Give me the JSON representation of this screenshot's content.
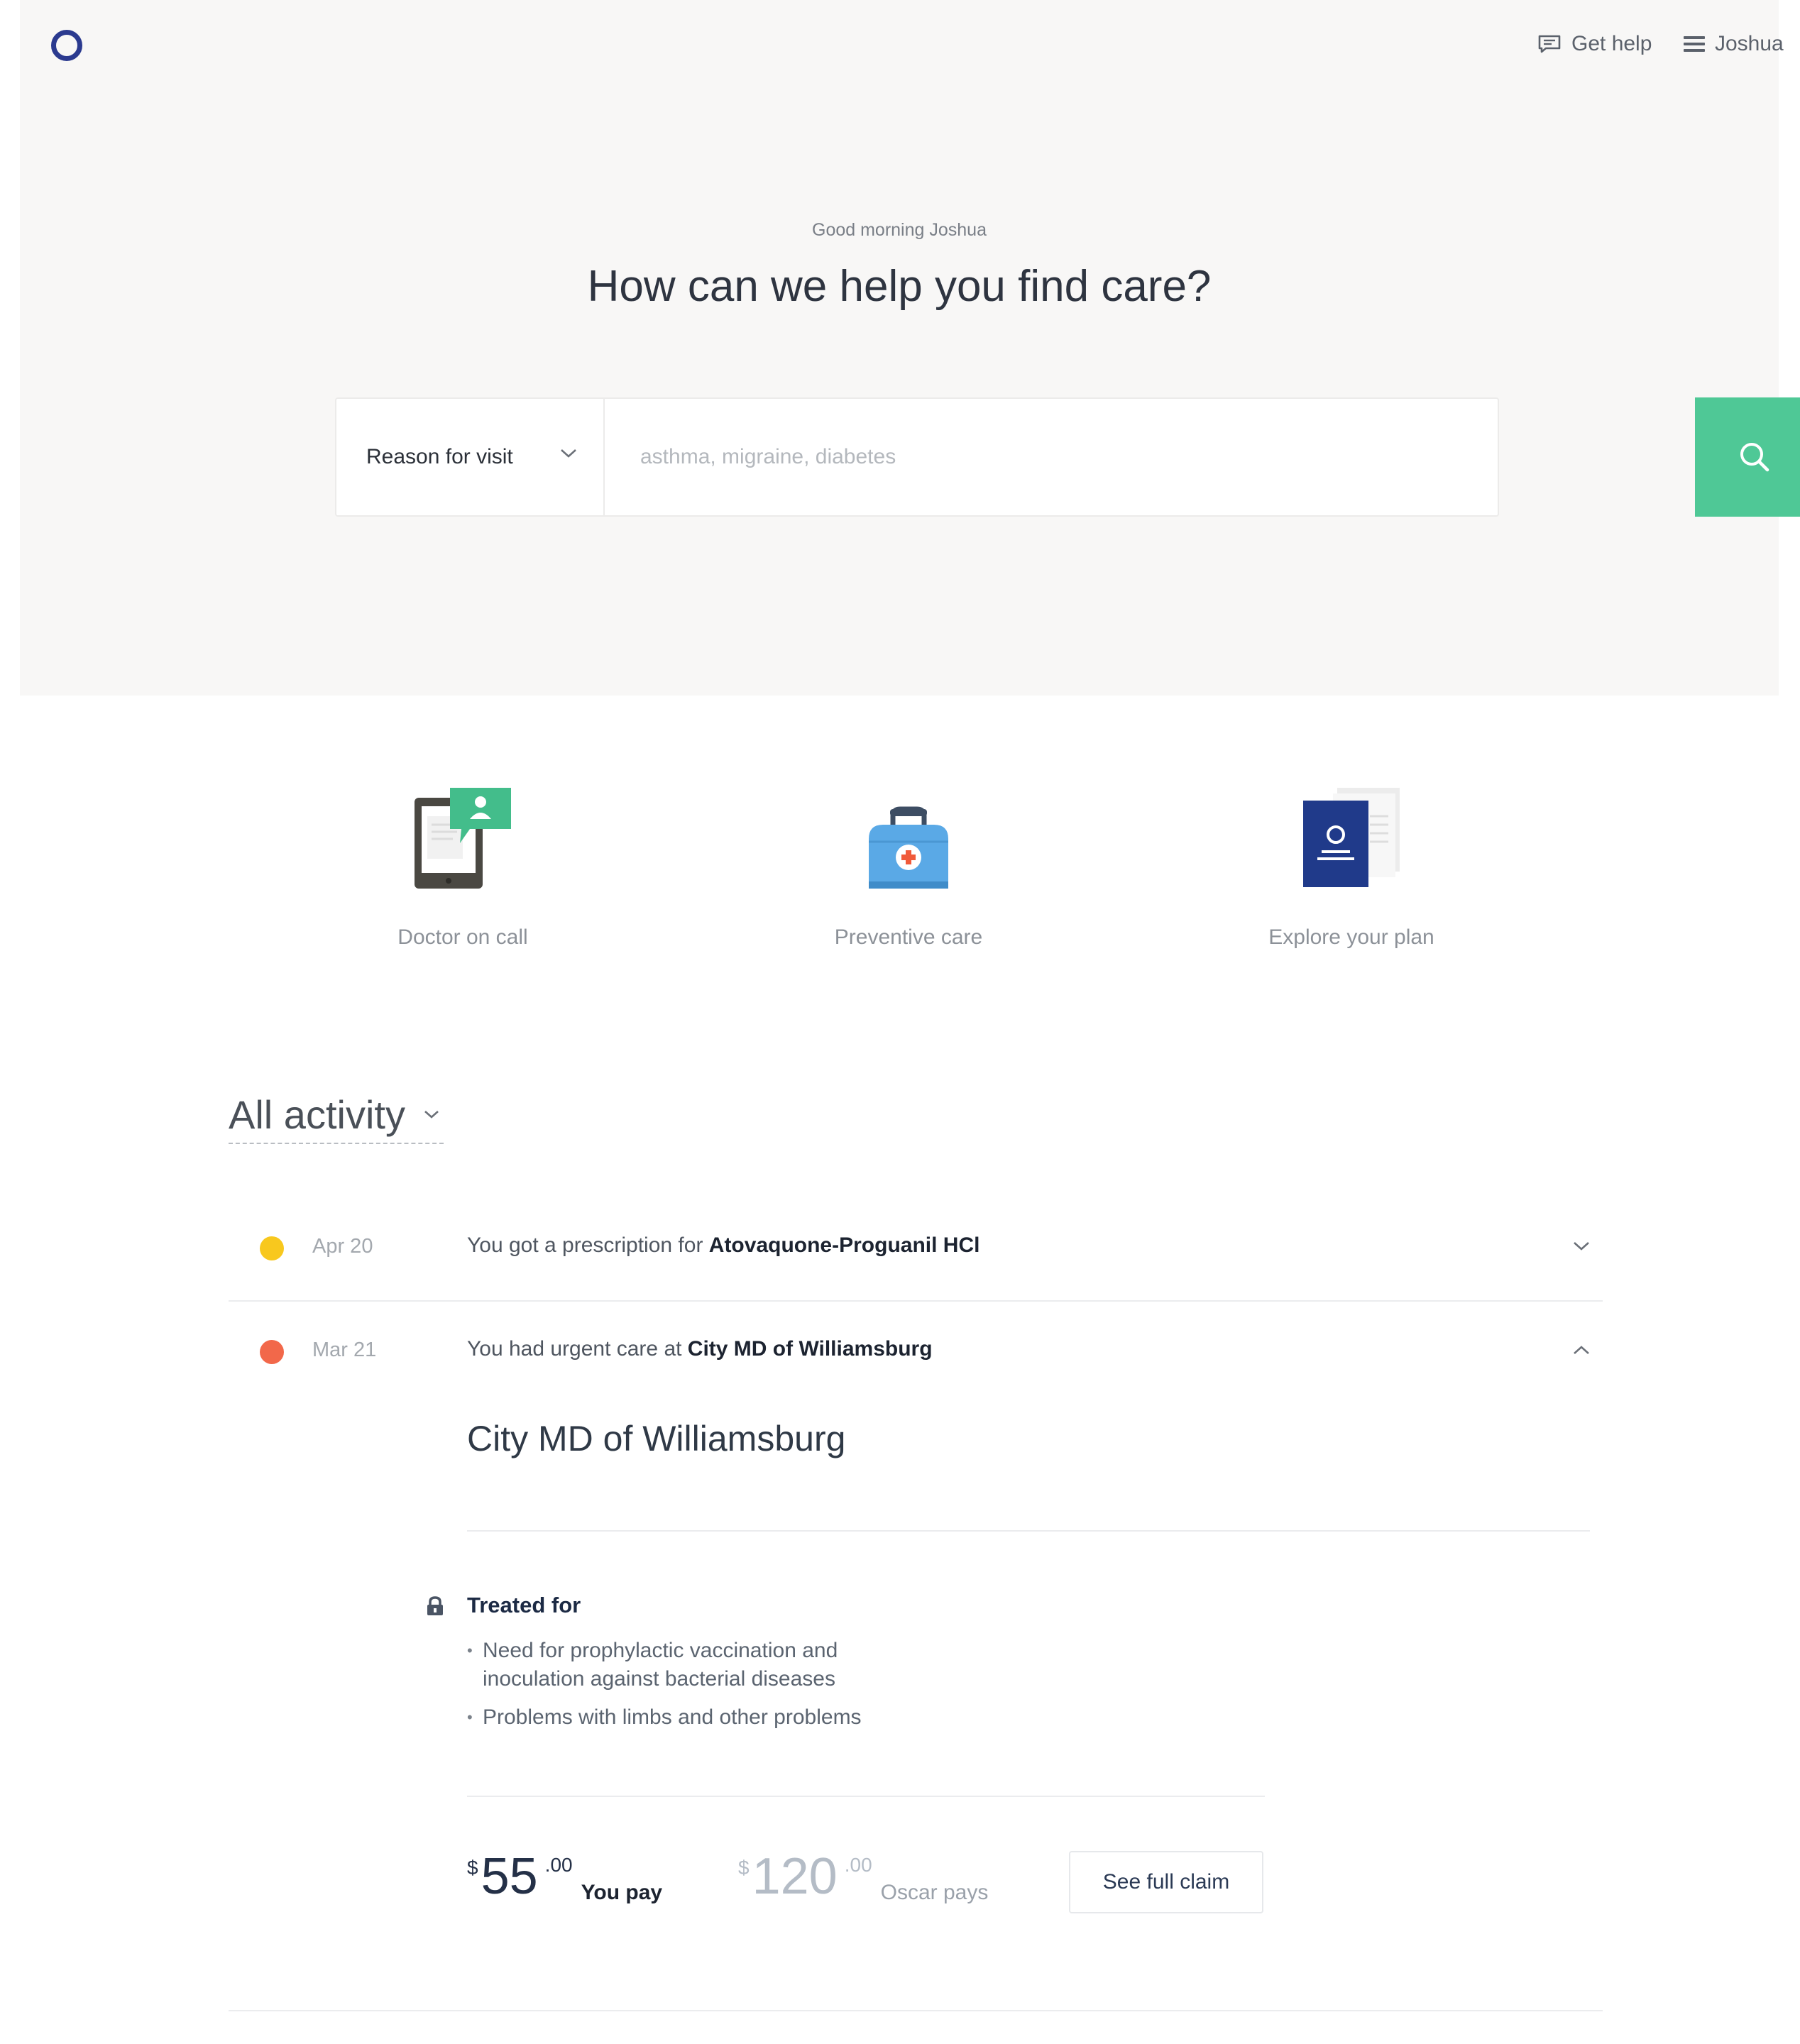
{
  "header": {
    "logo": "oscar-logo",
    "help_label": "Get help",
    "user_label": "Joshua"
  },
  "hero": {
    "greeting": "Good morning Joshua",
    "headline": "How can we help you find care?",
    "search": {
      "select_value": "Reason for visit",
      "placeholder": "asthma, migraine, diabetes",
      "value": ""
    }
  },
  "tiles": [
    {
      "label": "Doctor on call",
      "icon": "tablet-chat-icon"
    },
    {
      "label": "Preventive care",
      "icon": "medical-bag-icon"
    },
    {
      "label": "Explore your plan",
      "icon": "id-card-icon"
    }
  ],
  "activity": {
    "filter_label": "All activity",
    "items": [
      {
        "date": "Apr 20",
        "text": "You got a prescription for ",
        "bold": "Atovaquone-Proguanil HCl",
        "dot_color": "#f8c81e",
        "expanded": false
      },
      {
        "date": "Mar 21",
        "text": "You had urgent care at ",
        "bold": "City MD of Williamsburg",
        "dot_color": "#f2684a",
        "expanded": true
      }
    ],
    "detail": {
      "title": "City MD of Williamsburg",
      "treated_label": "Treated for",
      "treated_items": [
        "Need for prophylactic vaccination and inoculation against bacterial diseases",
        "Problems with limbs and other problems"
      ],
      "you_pay": {
        "currency": "$",
        "dollars": "55",
        "cents": ".00",
        "label": "You pay"
      },
      "oscar_pays": {
        "currency": "$",
        "dollars": "120",
        "cents": ".00",
        "label": "Oscar pays"
      },
      "claim_button": "See full claim"
    }
  },
  "colors": {
    "accent": "#4fc896",
    "brand": "#2b3a8f",
    "hero_bg": "#f8f7f6"
  }
}
